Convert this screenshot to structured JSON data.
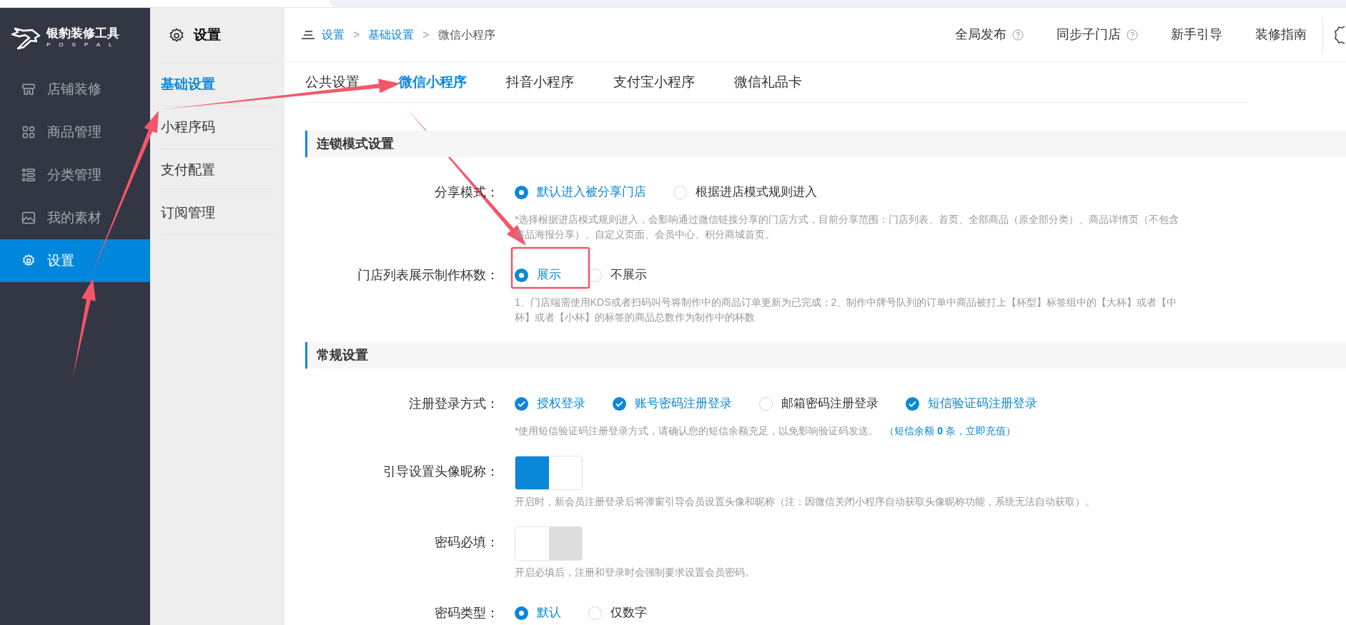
{
  "logo": {
    "name": "银豹装修工具",
    "sub": "POSPAL"
  },
  "nav": [
    {
      "label": "店铺装修",
      "selected": false
    },
    {
      "label": "商品管理",
      "selected": false
    },
    {
      "label": "分类管理",
      "selected": false
    },
    {
      "label": "我的素材",
      "selected": false
    },
    {
      "label": "设置",
      "selected": true
    }
  ],
  "subnav": {
    "title": "设置",
    "items": [
      {
        "label": "基础设置",
        "selected": true
      },
      {
        "label": "小程序码",
        "selected": false
      },
      {
        "label": "支付配置",
        "selected": false
      },
      {
        "label": "订阅管理",
        "selected": false
      }
    ]
  },
  "breadcrumb": {
    "separator": ">",
    "items": [
      "设置",
      "基础设置",
      "微信小程序"
    ]
  },
  "header_links": [
    {
      "label": "全局发布",
      "help": true
    },
    {
      "label": "同步子门店",
      "help": true
    },
    {
      "label": "新手引导",
      "help": false
    },
    {
      "label": "装修指南",
      "help": false
    }
  ],
  "tabs": [
    {
      "label": "公共设置",
      "selected": false
    },
    {
      "label": "微信小程序",
      "selected": true
    },
    {
      "label": "抖音小程序",
      "selected": false
    },
    {
      "label": "支付宝小程序",
      "selected": false
    },
    {
      "label": "微信礼品卡",
      "selected": false
    }
  ],
  "sections": [
    {
      "title": "连锁模式设置",
      "rows": [
        {
          "kind": "radio",
          "label": "分享模式：",
          "options": [
            {
              "label": "默认进入被分享门店",
              "selected": true
            },
            {
              "label": "根据进店模式规则进入",
              "selected": false
            }
          ],
          "note": "*选择根据进店模式规则进入，会影响通过微信链接分享的门店方式，目前分享范围：门店列表、首页、全部商品（原全部分类）、商品详情页（不包含商品海报分享）、自定义页面、会员中心、积分商城首页。"
        },
        {
          "kind": "radio",
          "label": "门店列表展示制作杯数：",
          "options": [
            {
              "label": "展示",
              "selected": true
            },
            {
              "label": "不展示",
              "selected": false
            }
          ],
          "note": "1、门店端需使用KDS或者扫码叫号将制作中的商品订单更新为已完成；2、制作中牌号队列的订单中商品被打上【杯型】标签组中的【大杯】或者【中杯】或者【小杯】的标签的商品总数作为制作中的杯数"
        }
      ]
    },
    {
      "title": "常规设置",
      "rows": [
        {
          "kind": "checkbox",
          "label": "注册登录方式：",
          "options": [
            {
              "label": "授权登录",
              "checked": true
            },
            {
              "label": "账号密码注册登录",
              "checked": true
            },
            {
              "label": "邮箱密码注册登录",
              "checked": false
            },
            {
              "label": "短信验证码注册登录",
              "checked": true
            }
          ],
          "note": "*使用短信验证码注册登录方式，请确认您的短信余额充足，以免影响验证码发送。",
          "link": "（短信余额 **0** 条，立即充值）"
        },
        {
          "kind": "toggle",
          "label": "引导设置头像昵称：",
          "on": true,
          "note": "开启时，新会员注册登录后将弹窗引导会员设置头像和昵称（注：因微信关闭小程序自动获取头像昵称功能，系统无法自动获取）。"
        },
        {
          "kind": "toggle",
          "label": "密码必填：",
          "on": false,
          "note": "开启必填后，注册和登录时会强制要求设置会员密码。"
        },
        {
          "kind": "radio",
          "label": "密码类型：",
          "options": [
            {
              "label": "默认",
              "selected": true
            },
            {
              "label": "仅数字",
              "selected": false
            }
          ]
        }
      ]
    }
  ],
  "annotations": [
    {
      "kind": "arrow"
    },
    {
      "kind": "arrow"
    },
    {
      "kind": "arrow"
    },
    {
      "kind": "arrow"
    },
    {
      "kind": "box"
    }
  ]
}
